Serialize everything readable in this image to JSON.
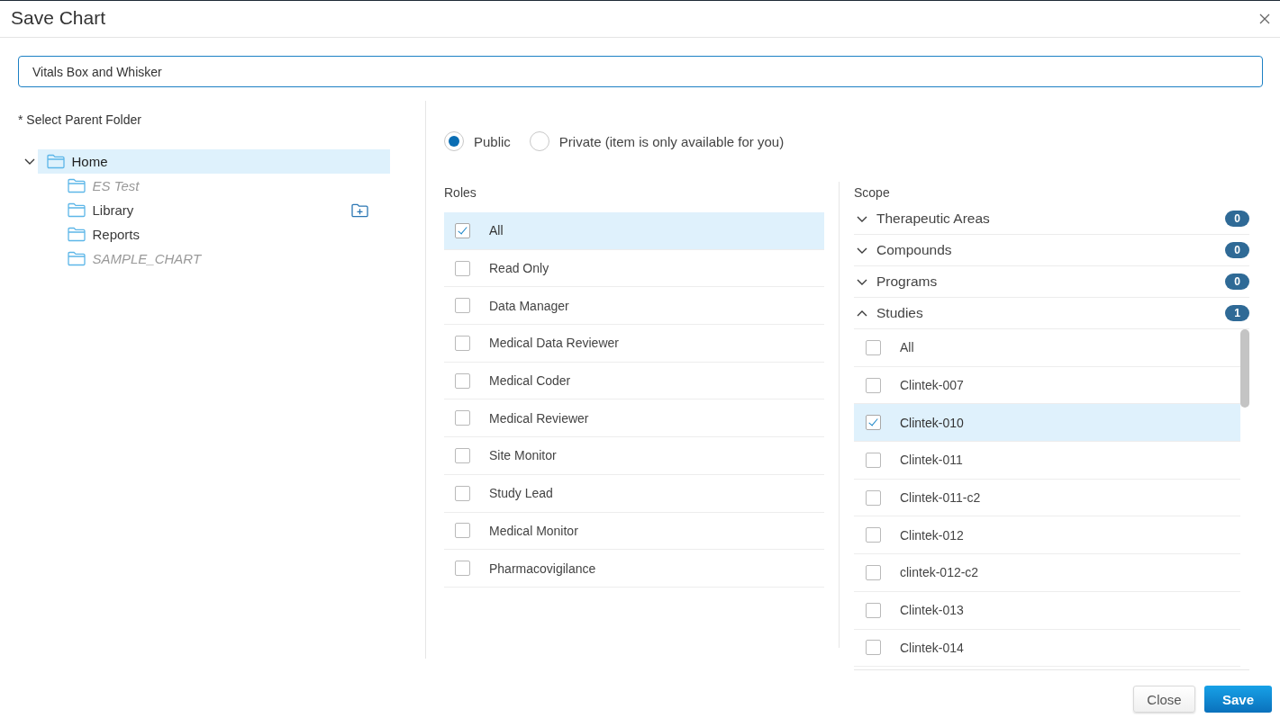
{
  "dialog": {
    "title": "Save Chart"
  },
  "name_field": {
    "value": "Vitals Box and Whisker",
    "focused": true
  },
  "folder_tree": {
    "label": "* Select Parent Folder",
    "items": [
      {
        "label": "Home",
        "selected": true,
        "expanded": true,
        "disabled": false,
        "hovered": false,
        "children": [
          {
            "label": "ES Test",
            "selected": false,
            "disabled": true,
            "hovered": false
          },
          {
            "label": "Library",
            "selected": false,
            "disabled": false,
            "hovered": true
          },
          {
            "label": "Reports",
            "selected": false,
            "disabled": false,
            "hovered": false
          },
          {
            "label": "SAMPLE_CHART",
            "selected": false,
            "disabled": true,
            "hovered": false
          }
        ]
      }
    ]
  },
  "visibility": [
    {
      "label": "Public",
      "selected": true
    },
    {
      "label": "Private (item is only available for you)",
      "selected": false
    }
  ],
  "roles": {
    "heading": "Roles",
    "items": [
      {
        "label": "All",
        "checked": true
      },
      {
        "label": "Read Only",
        "checked": false
      },
      {
        "label": "Data Manager",
        "checked": false
      },
      {
        "label": "Medical Data Reviewer",
        "checked": false
      },
      {
        "label": "Medical Coder",
        "checked": false
      },
      {
        "label": "Medical Reviewer",
        "checked": false
      },
      {
        "label": "Site Monitor",
        "checked": false
      },
      {
        "label": "Study Lead",
        "checked": false
      },
      {
        "label": "Medical Monitor",
        "checked": false
      },
      {
        "label": "Pharmacovigilance",
        "checked": false
      }
    ]
  },
  "scope": {
    "heading": "Scope",
    "groups": [
      {
        "label": "Therapeutic Areas",
        "count": "0",
        "expanded": false
      },
      {
        "label": "Compounds",
        "count": "0",
        "expanded": false
      },
      {
        "label": "Programs",
        "count": "0",
        "expanded": false
      },
      {
        "label": "Studies",
        "count": "1",
        "expanded": true,
        "items": [
          {
            "label": "All",
            "checked": false
          },
          {
            "label": "Clintek-007",
            "checked": false
          },
          {
            "label": "Clintek-010",
            "checked": true
          },
          {
            "label": "Clintek-011",
            "checked": false
          },
          {
            "label": "Clintek-011-c2",
            "checked": false
          },
          {
            "label": "Clintek-012",
            "checked": false
          },
          {
            "label": "clintek-012-c2",
            "checked": false
          },
          {
            "label": "Clintek-013",
            "checked": false
          },
          {
            "label": "Clintek-014",
            "checked": false
          }
        ]
      }
    ]
  },
  "buttons": [
    {
      "label": "Close",
      "kind": "secondary"
    },
    {
      "label": "Save",
      "kind": "primary"
    }
  ]
}
